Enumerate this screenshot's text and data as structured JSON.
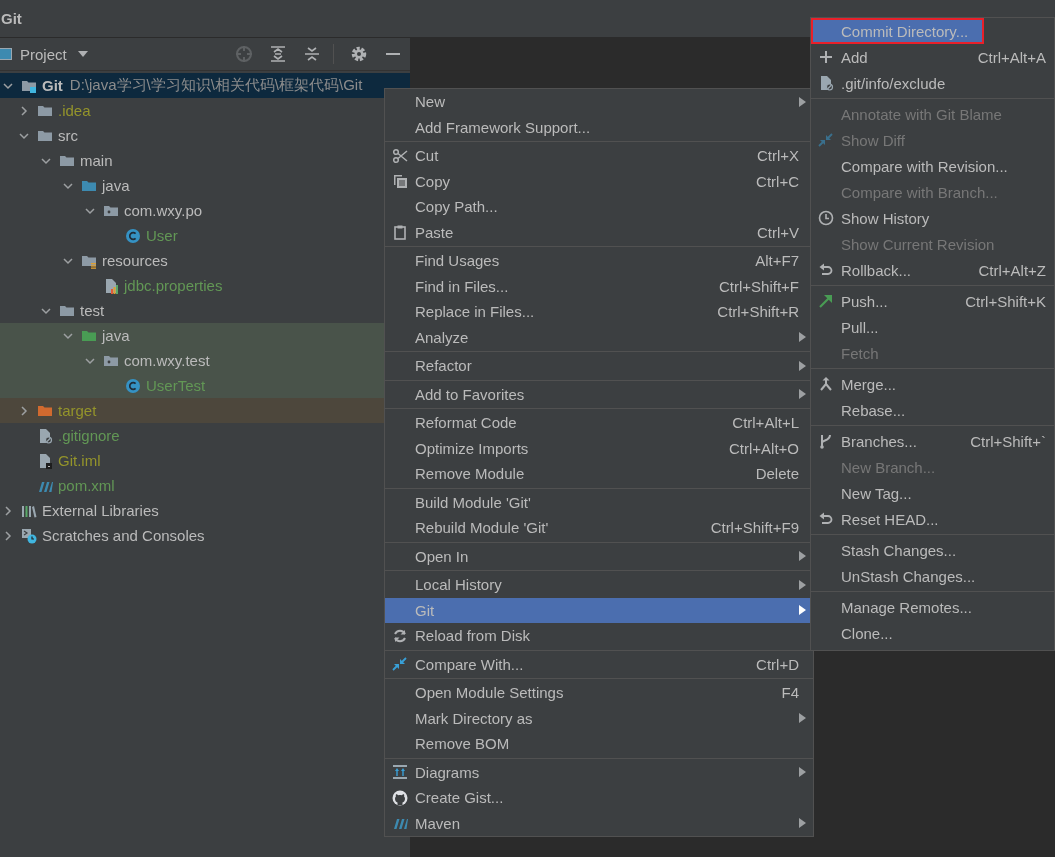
{
  "window": {
    "title": "Git"
  },
  "project_panel": {
    "title": "Project"
  },
  "tree": [
    {
      "name": "Git",
      "path": "D:\\java学习\\学习知识\\相关代码\\框架代码\\Git",
      "kind": "module",
      "color": "#bbbbbb",
      "expanded": true,
      "selected": true,
      "children": [
        {
          "name": ".idea",
          "kind": "folder",
          "color": "#94942b",
          "expanded": false,
          "selected": false
        },
        {
          "name": "src",
          "kind": "folder",
          "color": "#bbbbbb",
          "expanded": true,
          "selected": false,
          "children": [
            {
              "name": "main",
              "kind": "folder",
              "color": "#bbbbbb",
              "expanded": true,
              "selected": false,
              "children": [
                {
                  "name": "java",
                  "kind": "source-folder",
                  "color": "#bbbbbb",
                  "expanded": true,
                  "selected": false,
                  "children": [
                    {
                      "name": "com.wxy.po",
                      "kind": "package",
                      "color": "#bbbbbb",
                      "expanded": true,
                      "selected": false,
                      "children": [
                        {
                          "name": "User",
                          "kind": "class",
                          "color": "#629755",
                          "selected": false
                        }
                      ]
                    }
                  ]
                },
                {
                  "name": "resources",
                  "kind": "resources",
                  "color": "#bbbbbb",
                  "expanded": true,
                  "selected": false,
                  "children": [
                    {
                      "name": "jdbc.properties",
                      "kind": "properties",
                      "color": "#629755",
                      "selected": false
                    }
                  ]
                }
              ]
            },
            {
              "name": "test",
              "kind": "folder",
              "color": "#bbbbbb",
              "expanded": true,
              "selected": false,
              "children": [
                {
                  "name": "java",
                  "kind": "test-folder",
                  "color": "#bbbbbb",
                  "expanded": true,
                  "selected": false,
                  "children": [
                    {
                      "name": "com.wxy.test",
                      "kind": "package",
                      "color": "#bbbbbb",
                      "expanded": true,
                      "selected": false,
                      "children": [
                        {
                          "name": "UserTest",
                          "kind": "class",
                          "color": "#629755",
                          "selected": false
                        }
                      ]
                    }
                  ]
                }
              ]
            }
          ]
        },
        {
          "name": "target",
          "kind": "excluded-folder",
          "color": "#94942b",
          "expanded": false,
          "selected": false
        },
        {
          "name": ".gitignore",
          "kind": "gitignore",
          "color": "#629755",
          "selected": false
        },
        {
          "name": "Git.iml",
          "kind": "iml",
          "color": "#94942b",
          "selected": false
        },
        {
          "name": "pom.xml",
          "kind": "maven",
          "color": "#629755",
          "selected": false
        }
      ]
    },
    {
      "name": "External Libraries",
      "kind": "libraries",
      "color": "#bbbbbb",
      "expanded": false,
      "selected": false
    },
    {
      "name": "Scratches and Consoles",
      "kind": "scratches",
      "color": "#bbbbbb",
      "expanded": false,
      "selected": false
    }
  ],
  "context_menu": {
    "groups": [
      [
        {
          "label": "New",
          "submenu": true,
          "selected": false
        },
        {
          "label": "Add Framework Support...",
          "submenu": false,
          "selected": false
        }
      ],
      [
        {
          "label": "Cut",
          "shortcut": "Ctrl+X",
          "submenu": false,
          "selected": false
        },
        {
          "label": "Copy",
          "shortcut": "Ctrl+C",
          "submenu": false,
          "selected": false
        },
        {
          "label": "Copy Path...",
          "submenu": false,
          "selected": false
        },
        {
          "label": "Paste",
          "shortcut": "Ctrl+V",
          "submenu": false,
          "selected": false
        }
      ],
      [
        {
          "label": "Find Usages",
          "shortcut": "Alt+F7",
          "submenu": false,
          "selected": false
        },
        {
          "label": "Find in Files...",
          "shortcut": "Ctrl+Shift+F",
          "submenu": false,
          "selected": false
        },
        {
          "label": "Replace in Files...",
          "shortcut": "Ctrl+Shift+R",
          "submenu": false,
          "selected": false
        },
        {
          "label": "Analyze",
          "submenu": true,
          "selected": false
        }
      ],
      [
        {
          "label": "Refactor",
          "submenu": true,
          "selected": false
        }
      ],
      [
        {
          "label": "Add to Favorites",
          "submenu": true,
          "selected": false
        }
      ],
      [
        {
          "label": "Reformat Code",
          "shortcut": "Ctrl+Alt+L",
          "submenu": false,
          "selected": false
        },
        {
          "label": "Optimize Imports",
          "shortcut": "Ctrl+Alt+O",
          "submenu": false,
          "selected": false
        },
        {
          "label": "Remove Module",
          "shortcut": "Delete",
          "submenu": false,
          "selected": false
        }
      ],
      [
        {
          "label": "Build Module 'Git'",
          "submenu": false,
          "selected": false
        },
        {
          "label": "Rebuild Module 'Git'",
          "shortcut": "Ctrl+Shift+F9",
          "submenu": false,
          "selected": false
        }
      ],
      [
        {
          "label": "Open In",
          "submenu": true,
          "selected": false
        }
      ],
      [
        {
          "label": "Local History",
          "submenu": true,
          "selected": false
        },
        {
          "label": "Git",
          "submenu": true,
          "selected": true
        },
        {
          "label": "Reload from Disk",
          "submenu": false,
          "selected": false
        }
      ],
      [
        {
          "label": "Compare With...",
          "shortcut": "Ctrl+D",
          "submenu": false,
          "selected": false
        }
      ],
      [
        {
          "label": "Open Module Settings",
          "shortcut": "F4",
          "submenu": false,
          "selected": false
        },
        {
          "label": "Mark Directory as",
          "submenu": true,
          "selected": false
        },
        {
          "label": "Remove BOM",
          "submenu": false,
          "selected": false
        }
      ],
      [
        {
          "label": "Diagrams",
          "submenu": true,
          "selected": false
        },
        {
          "label": "Create Gist...",
          "submenu": false,
          "selected": false
        },
        {
          "label": "Maven",
          "submenu": true,
          "selected": false
        }
      ]
    ]
  },
  "git_menu": {
    "groups": [
      [
        {
          "label": "Commit Directory...",
          "selected": true,
          "disabled": false,
          "outlined": true
        },
        {
          "label": "Add",
          "shortcut": "Ctrl+Alt+A",
          "selected": false,
          "disabled": false
        },
        {
          "label": ".git/info/exclude",
          "selected": false,
          "disabled": false
        }
      ],
      [
        {
          "label": "Annotate with Git Blame",
          "selected": false,
          "disabled": true
        },
        {
          "label": "Show Diff",
          "selected": false,
          "disabled": true
        },
        {
          "label": "Compare with Revision...",
          "selected": false,
          "disabled": false
        },
        {
          "label": "Compare with Branch...",
          "selected": false,
          "disabled": true
        },
        {
          "label": "Show History",
          "selected": false,
          "disabled": false
        },
        {
          "label": "Show Current Revision",
          "selected": false,
          "disabled": true
        },
        {
          "label": "Rollback...",
          "shortcut": "Ctrl+Alt+Z",
          "selected": false,
          "disabled": false
        }
      ],
      [
        {
          "label": "Push...",
          "shortcut": "Ctrl+Shift+K",
          "selected": false,
          "disabled": false
        },
        {
          "label": "Pull...",
          "selected": false,
          "disabled": false
        },
        {
          "label": "Fetch",
          "selected": false,
          "disabled": true
        }
      ],
      [
        {
          "label": "Merge...",
          "selected": false,
          "disabled": false
        },
        {
          "label": "Rebase...",
          "selected": false,
          "disabled": false
        }
      ],
      [
        {
          "label": "Branches...",
          "shortcut": "Ctrl+Shift+`",
          "selected": false,
          "disabled": false
        },
        {
          "label": "New Branch...",
          "selected": false,
          "disabled": true
        },
        {
          "label": "New Tag...",
          "selected": false,
          "disabled": false
        },
        {
          "label": "Reset HEAD...",
          "selected": false,
          "disabled": false
        }
      ],
      [
        {
          "label": "Stash Changes...",
          "selected": false,
          "disabled": false
        },
        {
          "label": "UnStash Changes...",
          "selected": false,
          "disabled": false
        }
      ],
      [
        {
          "label": "Manage Remotes...",
          "selected": false,
          "disabled": false
        },
        {
          "label": "Clone...",
          "selected": false,
          "disabled": false
        }
      ]
    ]
  }
}
